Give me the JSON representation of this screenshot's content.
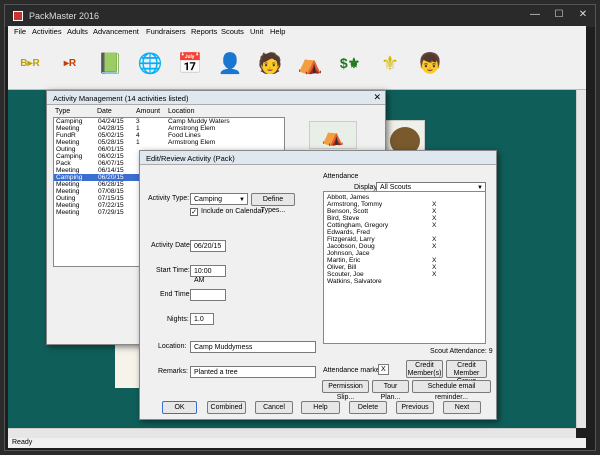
{
  "window": {
    "title": "PackMaster 2016",
    "min": "—",
    "max": "☐",
    "close": "✕"
  },
  "menu": [
    "File",
    "Activities",
    "Adults",
    "Advancement",
    "Fundraisers",
    "Reports",
    "Scouts",
    "Unit",
    "Help"
  ],
  "toolbar": [
    {
      "name": "import-export-icon",
      "glyph": "B▸R"
    },
    {
      "name": "import-data-icon",
      "glyph": "▸R"
    },
    {
      "name": "notebook-icon",
      "glyph": "📗"
    },
    {
      "name": "globe-icon",
      "glyph": "🌐"
    },
    {
      "name": "calendar-icon",
      "glyph": "📅"
    },
    {
      "name": "leader-icon",
      "glyph": "👤"
    },
    {
      "name": "adult-icon",
      "glyph": "🧑"
    },
    {
      "name": "tent-icon",
      "glyph": "⛺"
    },
    {
      "name": "money-fleur-icon",
      "glyph": "$⚜"
    },
    {
      "name": "fleur-de-lis-icon",
      "glyph": "⚜"
    },
    {
      "name": "scout-icon",
      "glyph": "👦"
    }
  ],
  "status": {
    "text": "Ready"
  },
  "activity_management": {
    "title": "Activity Management  (14 activities listed)",
    "columns": [
      "Type",
      "Date",
      "Amount",
      "Location"
    ],
    "rows": [
      [
        "Camping",
        "04/24/15",
        "3",
        "Camp Muddy Waters"
      ],
      [
        "Meeting",
        "04/28/15",
        "1",
        "Armstrong Elem"
      ],
      [
        "FundR",
        "05/02/15",
        "4",
        "Food Lines"
      ],
      [
        "Meeting",
        "05/28/15",
        "1",
        "Armstrong Elem"
      ],
      [
        "Outing",
        "06/01/15",
        "",
        ""
      ],
      [
        "Camping",
        "06/02/15",
        "",
        ""
      ],
      [
        "Pack",
        "06/07/15",
        "",
        ""
      ],
      [
        "Meeting",
        "06/14/15",
        "",
        ""
      ],
      [
        "Camping",
        "06/20/15",
        "",
        ""
      ],
      [
        "Meeting",
        "06/28/15",
        "",
        ""
      ],
      [
        "Meeting",
        "07/08/15",
        "",
        ""
      ],
      [
        "Outing",
        "07/15/15",
        "",
        ""
      ],
      [
        "Meeting",
        "07/22/15",
        "",
        ""
      ],
      [
        "Meeting",
        "07/29/15",
        "",
        ""
      ]
    ],
    "selected_index": 8
  },
  "editor": {
    "title": "Edit/Review Activity  (Pack)",
    "activity_type_label": "Activity Type:",
    "activity_type_value": "Camping",
    "define_types": "Define Types...",
    "include_calendar": "Include on Calendar",
    "include_calendar_checked": "✓",
    "activity_date_label": "Activity Date:",
    "activity_date_value": "06/20/15",
    "start_time_label": "Start Time:",
    "start_time_value": "10:00 AM",
    "end_time_label": "End Time:",
    "end_time_value": "",
    "nights_label": "Nights:",
    "nights_value": "1.0",
    "location_label": "Location:",
    "location_value": "Camp Muddymess",
    "remarks_label": "Remarks:",
    "remarks_value": "Planted a tree",
    "attendance_label": "Attendance",
    "display_label": "Display:",
    "display_value": "All Scouts",
    "scouts": [
      {
        "name": "Abbott,  James",
        "mark": ""
      },
      {
        "name": "Armstrong,  Tommy",
        "mark": "X"
      },
      {
        "name": "Benson,  Scott",
        "mark": "X"
      },
      {
        "name": "Bird,  Steve",
        "mark": "X"
      },
      {
        "name": "Cottingham,  Gregory",
        "mark": "X"
      },
      {
        "name": "Edwards,  Fred",
        "mark": ""
      },
      {
        "name": "Fitzgerald,  Larry",
        "mark": "X"
      },
      {
        "name": "Jacobson,  Doug",
        "mark": "X"
      },
      {
        "name": "Johnson,  Jace",
        "mark": ""
      },
      {
        "name": "Martin,  Eric",
        "mark": "X"
      },
      {
        "name": "Oliver,  Bill",
        "mark": "X"
      },
      {
        "name": "Scouter,  Joe",
        "mark": "X"
      },
      {
        "name": "Watkins,  Salvatore",
        "mark": ""
      }
    ],
    "scout_attendance": "Scout Attendance: 9",
    "attendance_marker_label": "Attendance marker:",
    "attendance_marker_value": "X",
    "credit_member_1": "Credit",
    "credit_member_2": "Member(s)",
    "credit_group_1": "Credit",
    "credit_group_2": "Member Group",
    "permission_slip": "Permission Slip...",
    "tour_plan": "Tour Plan...",
    "email_reminder": "Schedule email reminder...",
    "ok": "OK",
    "combined": "Combined",
    "cancel": "Cancel",
    "help": "Help",
    "delete": "Delete",
    "previous": "Previous",
    "next": "Next"
  }
}
